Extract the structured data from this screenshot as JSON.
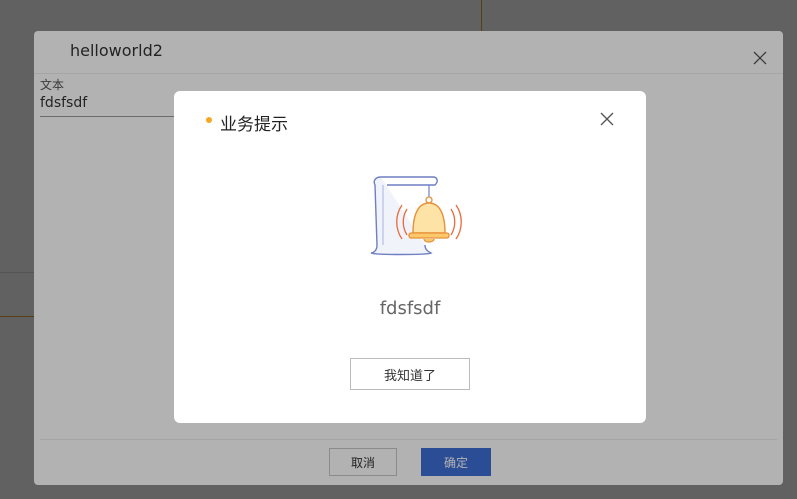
{
  "dialog": {
    "title": "helloworld2",
    "field": {
      "label": "文本",
      "value": "fdsfsdf"
    },
    "footer": {
      "cancel_label": "取消",
      "confirm_label": "确定"
    }
  },
  "alert": {
    "title": "业务提示",
    "message": "fdsfsdf",
    "button_label": "我知道了",
    "accent_color": "#f6a623",
    "illustration": "bell-scroll-icon"
  },
  "colors": {
    "primary_button": "#3e6fd6",
    "background_accent_line": "#e8a33a"
  }
}
